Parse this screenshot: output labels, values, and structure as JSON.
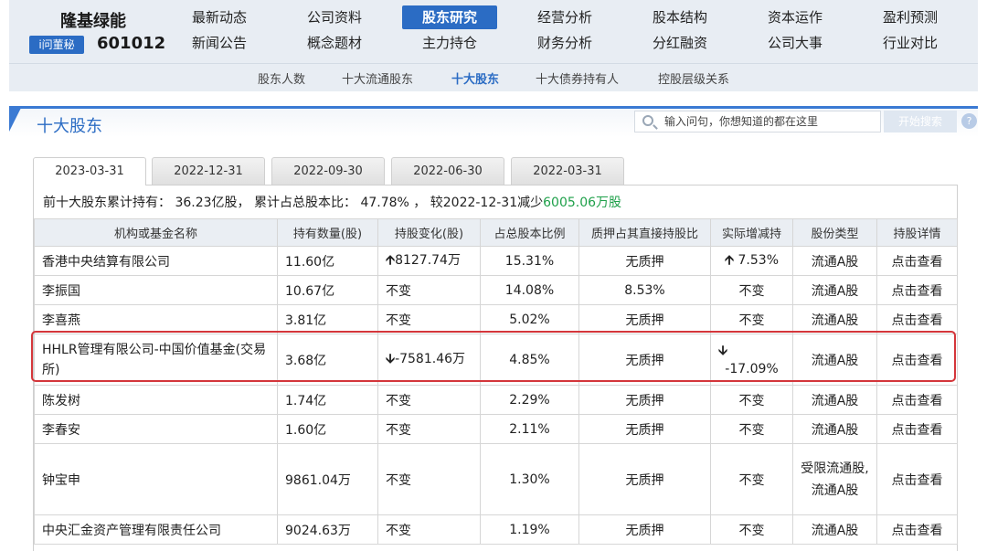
{
  "header": {
    "stock_name": "隆基绿能",
    "ask_badge": "i问董秘",
    "stock_code": "601012",
    "nav_row1": [
      "最新动态",
      "公司资料",
      "股东研究",
      "经营分析",
      "股本结构",
      "资本运作",
      "盈利预测"
    ],
    "nav_row2": [
      "新闻公告",
      "概念题材",
      "主力持仓",
      "财务分析",
      "分红融资",
      "公司大事",
      "行业对比"
    ],
    "active_nav": "股东研究"
  },
  "subnav": {
    "items": [
      "股东人数",
      "十大流通股东",
      "十大股东",
      "十大债券持有人",
      "控股层级关系"
    ],
    "active": "十大股东"
  },
  "section": {
    "title": "十大股东",
    "search_placeholder": "输入问句，你想知道的都在这里",
    "search_button": "开始搜索",
    "help_icon": "help-icon"
  },
  "date_tabs": {
    "items": [
      "2023-03-31",
      "2022-12-31",
      "2022-09-30",
      "2022-06-30",
      "2022-03-31"
    ],
    "active": "2023-03-31"
  },
  "summary": {
    "prefix": "前十大股东累计持有：",
    "total_shares": "36.23亿股",
    "ratio_label": "累计占总股本比：",
    "ratio": "47.78%",
    "compare_text": "较2022-12-31减少",
    "change": "6005.06万股"
  },
  "table": {
    "columns": [
      "机构或基金名称",
      "持有数量(股)",
      "持股变化(股)",
      "占总股本比例",
      "质押占其直接持股比",
      "实际增减持",
      "股份类型",
      "持股详情"
    ],
    "rows": [
      {
        "name": "香港中央结算有限公司",
        "shares": "11.60亿",
        "change": "8127.74万",
        "change_dir": "up",
        "ratio": "15.31%",
        "pledge": "无质押",
        "actual": "7.53%",
        "actual_dir": "up",
        "type": "流通A股",
        "detail": "点击查看"
      },
      {
        "name": "李振国",
        "shares": "10.67亿",
        "change": "不变",
        "change_dir": "none",
        "ratio": "14.08%",
        "pledge": "8.53%",
        "actual": "不变",
        "actual_dir": "none",
        "type": "流通A股",
        "detail": "点击查看"
      },
      {
        "name": "李喜燕",
        "shares": "3.81亿",
        "change": "不变",
        "change_dir": "none",
        "ratio": "5.02%",
        "pledge": "无质押",
        "actual": "不变",
        "actual_dir": "none",
        "type": "流通A股",
        "detail": "点击查看"
      },
      {
        "name": "HHLR管理有限公司-中国价值基金(交易所)",
        "shares": "3.68亿",
        "change": "-7581.46万",
        "change_dir": "down",
        "ratio": "4.85%",
        "pledge": "无质押",
        "actual": "-17.09%",
        "actual_dir": "down",
        "type": "流通A股",
        "detail": "点击查看"
      },
      {
        "name": "陈发树",
        "shares": "1.74亿",
        "change": "不变",
        "change_dir": "none",
        "ratio": "2.29%",
        "pledge": "无质押",
        "actual": "不变",
        "actual_dir": "none",
        "type": "流通A股",
        "detail": "点击查看"
      },
      {
        "name": "李春安",
        "shares": "1.60亿",
        "change": "不变",
        "change_dir": "none",
        "ratio": "2.11%",
        "pledge": "无质押",
        "actual": "不变",
        "actual_dir": "none",
        "type": "流通A股",
        "detail": "点击查看"
      },
      {
        "name": "钟宝申",
        "shares": "9861.04万",
        "change": "不变",
        "change_dir": "none",
        "ratio": "1.30%",
        "pledge": "无质押",
        "actual": "不变",
        "actual_dir": "none",
        "type": "受限流通股,流通A股",
        "detail": "点击查看"
      },
      {
        "name": "中央汇金资产管理有限责任公司",
        "shares": "9024.63万",
        "change": "不变",
        "change_dir": "none",
        "ratio": "1.19%",
        "pledge": "无质押",
        "actual": "不变",
        "actual_dir": "none",
        "type": "流通A股",
        "detail": "点击查看"
      }
    ]
  },
  "colors": {
    "accent": "#2b6cc4",
    "up": "#c8262c",
    "down": "#1fa04a",
    "highlight_outline": "#d4363b"
  }
}
